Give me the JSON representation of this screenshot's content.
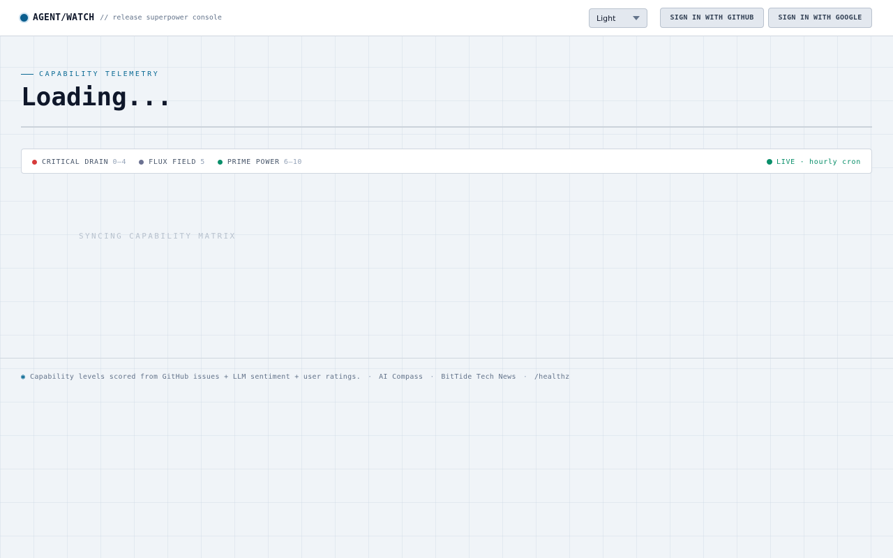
{
  "header": {
    "brand_name": "AGENT/WATCH",
    "brand_subtitle": "// release superpower console",
    "theme_select": {
      "value": "Light",
      "options": [
        "Light"
      ]
    },
    "github_button": "SIGN IN WITH GITHUB",
    "google_button": "SIGN IN WITH GOOGLE"
  },
  "main": {
    "eyebrow": "CAPABILITY TELEMETRY",
    "title": "Loading...",
    "legend": [
      {
        "label": "CRITICAL DRAIN",
        "range": "0–4",
        "color": "#d63b3b"
      },
      {
        "label": "FLUX FIELD",
        "range": "5",
        "color": "#6b7191"
      },
      {
        "label": "PRIME POWER",
        "range": "6–10",
        "color": "#0a8f6a"
      }
    ],
    "live_status": "LIVE · hourly cron",
    "live_color": "#0a8f6a",
    "syncing_text": "SYNCING CAPABILITY MATRIX"
  },
  "footer": {
    "icon": "info-dot-icon",
    "text": "Capability levels scored from GitHub issues + LLM sentiment + user ratings.",
    "links": [
      "AI Compass",
      "BitTide Tech News",
      "/healthz"
    ]
  },
  "colors": {
    "accent": "#0b6a94",
    "brand_dot": "#0b5e8e",
    "background": "#f0f4f8"
  }
}
